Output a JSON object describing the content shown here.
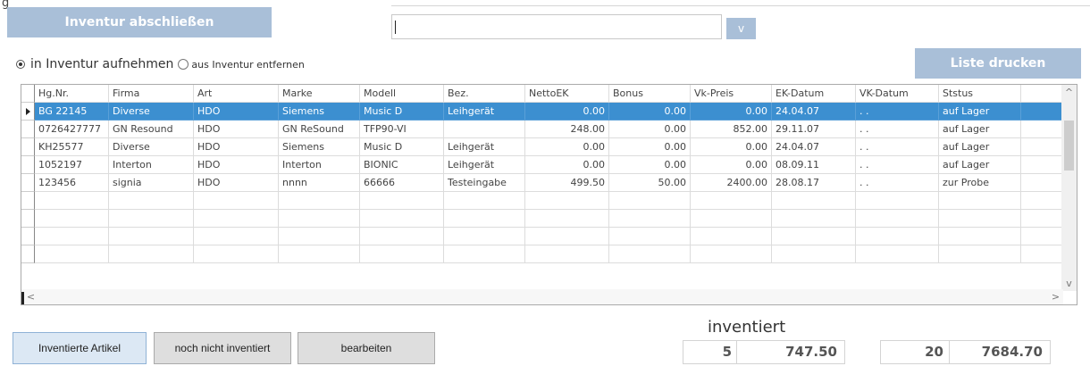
{
  "header": {
    "stray_glyph": "g",
    "inventory_close_label": "Inventur abschließen",
    "combo_value": "",
    "combo_dropdown_label": "v",
    "print_list_label": "Liste drucken"
  },
  "mode": {
    "option_add_label": "in Inventur aufnehmen",
    "option_remove_label": "aus Inventur entfernen",
    "selected": "add"
  },
  "table": {
    "columns": [
      "Hg.Nr.",
      "Firma",
      "Art",
      "Marke",
      "Modell",
      "Bez.",
      "NettoEK",
      "Bonus",
      "Vk-Preis",
      "EK-Datum",
      "VK-Datum",
      "Ststus"
    ],
    "rows": [
      [
        "BG 22145",
        "Diverse",
        "HDO",
        "Siemens",
        "Music D",
        "Leihgerät",
        "0.00",
        "0.00",
        "0.00",
        "24.04.07",
        " .  .",
        "auf Lager"
      ],
      [
        "0726427777",
        "GN Resound",
        "HDO",
        "GN ReSound",
        "TFP90-VI",
        "",
        "248.00",
        "0.00",
        "852.00",
        "29.11.07",
        " .  .",
        "auf Lager"
      ],
      [
        "KH25577",
        "Diverse",
        "HDO",
        "Siemens",
        "Music D",
        "Leihgerät",
        "0.00",
        "0.00",
        "0.00",
        "24.04.07",
        " .  .",
        "auf Lager"
      ],
      [
        "1052197",
        "Interton",
        "HDO",
        "Interton",
        "BIONIC",
        "Leihgerät",
        "0.00",
        "0.00",
        "0.00",
        "08.09.11",
        " .  .",
        "auf Lager"
      ],
      [
        "123456",
        "signia",
        "HDO",
        "nnnn",
        "66666",
        "Testeingabe",
        "499.50",
        "50.00",
        "2400.00",
        "28.08.17",
        " .  .",
        "zur Probe"
      ]
    ],
    "selected_row": 0,
    "empty_rows": 4
  },
  "scroll": {
    "up_arrow": "^",
    "down_arrow": "v",
    "left_arrow": "<",
    "right_arrow": ">"
  },
  "footer": {
    "btn_inventoried": "Inventierte Artikel",
    "btn_not_inventoried": "noch nicht inventiert",
    "btn_edit": "bearbeiten",
    "inventoried_label": "inventiert",
    "inventoried_count": "5",
    "inventoried_value": "747.50",
    "total_count": "20",
    "total_value": "7684.70"
  },
  "colors": {
    "accent_button": "#a9bfd8",
    "selection": "#3c8fd0"
  }
}
